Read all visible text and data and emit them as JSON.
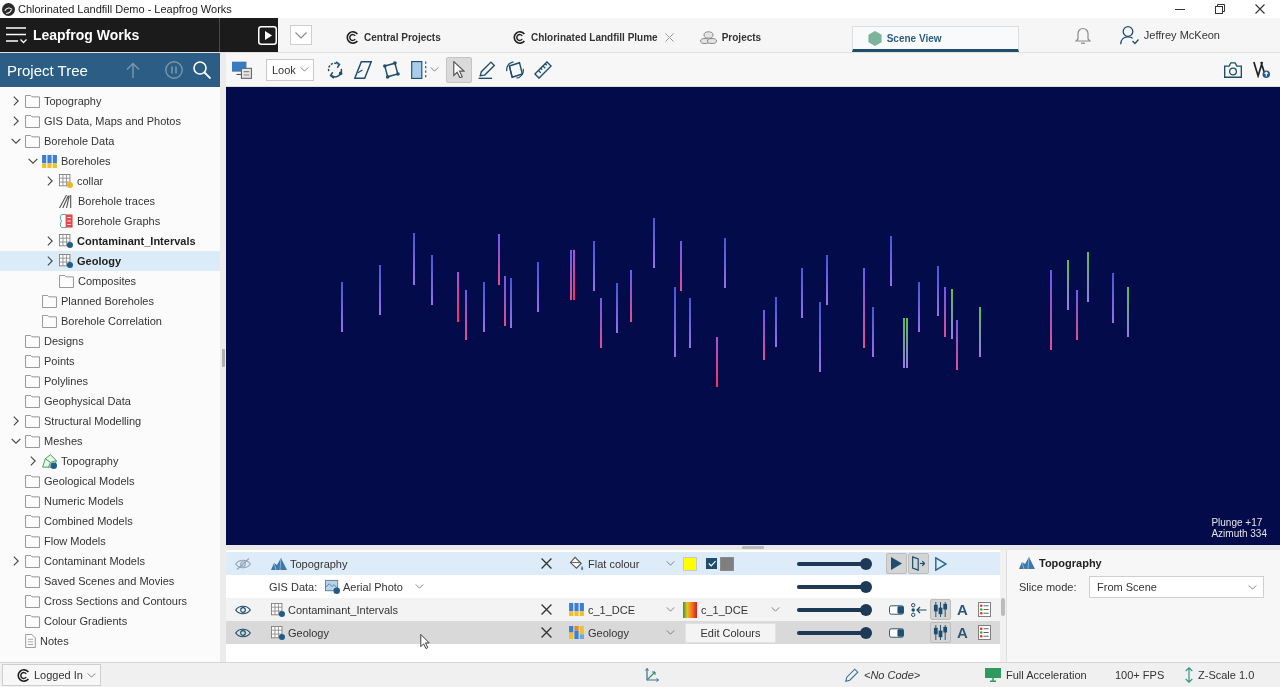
{
  "window": {
    "title": "Chlorinated Landfill Demo - Leapfrog Works"
  },
  "header": {
    "app_name": "Leapfrog Works",
    "tabs": [
      {
        "label": "Central Projects",
        "kind": "central",
        "closable": false,
        "selected": false
      },
      {
        "label": "Chlorinated Landfill Plume",
        "kind": "central",
        "closable": true,
        "selected": false
      },
      {
        "label": "Projects",
        "kind": "projects",
        "closable": false,
        "selected": false
      },
      {
        "label": "Scene View",
        "kind": "scene",
        "closable": false,
        "selected": true
      }
    ],
    "user": "Jeffrey McKeon"
  },
  "project_tree": {
    "title": "Project Tree",
    "tools": [
      {
        "kind": "up",
        "disabled": true
      },
      {
        "kind": "pause",
        "disabled": true
      },
      {
        "kind": "search",
        "disabled": false
      }
    ],
    "items": [
      {
        "label": "Topography",
        "kind": "folder",
        "expanded": false,
        "selected": false,
        "in_scene": false
      },
      {
        "label": "GIS Data, Maps and Photos",
        "kind": "folder",
        "expanded": false,
        "selected": false,
        "in_scene": false
      },
      {
        "label": "Borehole Data",
        "kind": "folder",
        "expanded": true,
        "selected": false,
        "in_scene": false,
        "children": [
          {
            "label": "Boreholes",
            "kind": "boreholes",
            "expanded": true,
            "selected": false,
            "in_scene": false,
            "children": [
              {
                "label": "collar",
                "kind": "table",
                "expanded": false,
                "selected": false,
                "in_scene": false
              },
              {
                "label": "Borehole traces",
                "kind": "traces",
                "selected": false,
                "in_scene": false
              },
              {
                "label": "Borehole Graphs",
                "kind": "graphs",
                "selected": false,
                "in_scene": false
              },
              {
                "label": "Contaminant_Intervals",
                "kind": "interval-table",
                "expanded": false,
                "selected": false,
                "in_scene": true
              },
              {
                "label": "Geology",
                "kind": "interval-table",
                "expanded": false,
                "selected": true,
                "in_scene": true
              },
              {
                "label": "Composites",
                "kind": "folder",
                "selected": false,
                "in_scene": false
              }
            ]
          },
          {
            "label": "Planned Boreholes",
            "kind": "folder",
            "selected": false,
            "in_scene": false
          },
          {
            "label": "Borehole Correlation",
            "kind": "folder",
            "selected": false,
            "in_scene": false
          }
        ]
      },
      {
        "label": "Designs",
        "kind": "folder",
        "selected": false,
        "in_scene": false
      },
      {
        "label": "Points",
        "kind": "folder",
        "selected": false,
        "in_scene": false
      },
      {
        "label": "Polylines",
        "kind": "folder",
        "selected": false,
        "in_scene": false
      },
      {
        "label": "Geophysical Data",
        "kind": "folder",
        "selected": false,
        "in_scene": false
      },
      {
        "label": "Structural Modelling",
        "kind": "folder",
        "expanded": false,
        "selected": false,
        "in_scene": false
      },
      {
        "label": "Meshes",
        "kind": "folder",
        "expanded": true,
        "selected": false,
        "in_scene": false,
        "children": [
          {
            "label": "Topography",
            "kind": "mesh",
            "expanded": false,
            "selected": false,
            "in_scene": false
          }
        ]
      },
      {
        "label": "Geological Models",
        "kind": "folder",
        "selected": false,
        "in_scene": false
      },
      {
        "label": "Numeric Models",
        "kind": "folder",
        "selected": false,
        "in_scene": false
      },
      {
        "label": "Combined Models",
        "kind": "folder",
        "selected": false,
        "in_scene": false
      },
      {
        "label": "Flow Models",
        "kind": "folder",
        "selected": false,
        "in_scene": false
      },
      {
        "label": "Contaminant Models",
        "kind": "folder",
        "expanded": false,
        "selected": false,
        "in_scene": false
      },
      {
        "label": "Saved Scenes and Movies",
        "kind": "folder",
        "selected": false,
        "in_scene": false
      },
      {
        "label": "Cross Sections and Contours",
        "kind": "folder",
        "selected": false,
        "in_scene": false
      },
      {
        "label": "Colour Gradients",
        "kind": "folder",
        "selected": false,
        "in_scene": false
      },
      {
        "label": "Notes",
        "kind": "notes",
        "selected": false,
        "in_scene": false
      }
    ]
  },
  "scene_toolbar": {
    "view_mode": "Look",
    "tools": [
      {
        "kind": "rotate",
        "pressed": false
      },
      {
        "kind": "plane",
        "pressed": false
      },
      {
        "kind": "plane-handles",
        "pressed": false
      },
      {
        "kind": "panel",
        "pressed": false
      },
      {
        "kind": "select",
        "pressed": true
      },
      {
        "kind": "draw-plane",
        "pressed": false
      },
      {
        "kind": "plane-rotate",
        "pressed": false
      },
      {
        "kind": "ruler",
        "pressed": false
      }
    ]
  },
  "scene": {
    "plunge": "Plunge +17",
    "azimuth": "Azimuth 334"
  },
  "shape_list": {
    "rows": [
      {
        "kind": "mesh",
        "name": "Topography",
        "visible": false,
        "selected": true,
        "hovered": false,
        "style": {
          "kind": "flat",
          "label": "Flat colour"
        },
        "colour": {
          "kind": "swatch",
          "color": "#ffff00"
        },
        "edge": {
          "checked": true,
          "color": "#7f7f7f"
        },
        "level": 1,
        "tools": [
          {
            "kind": "play",
            "pressed": true
          },
          {
            "kind": "slice",
            "pressed": true
          },
          {
            "kind": "outline-play",
            "pressed": false
          }
        ]
      },
      {
        "kind": "source",
        "label": "GIS Data:",
        "value": "Aerial Photo",
        "level": 1
      },
      {
        "kind": "table",
        "name": "Contaminant_Intervals",
        "visible": true,
        "selected": false,
        "hovered": false,
        "style": {
          "kind": "numeric",
          "label": "c_1_DCE"
        },
        "colour": {
          "kind": "gradient",
          "label": "c_1_DCE"
        },
        "level": 1,
        "tools": [
          {
            "kind": "toggle",
            "pressed": false
          },
          {
            "kind": "filter",
            "pressed": false
          },
          {
            "kind": "bars",
            "pressed": true
          },
          {
            "kind": "label",
            "glyph": "A",
            "pressed": false
          },
          {
            "kind": "legend",
            "pressed": false
          }
        ]
      },
      {
        "kind": "table",
        "name": "Geology",
        "visible": true,
        "selected": false,
        "hovered": true,
        "style": {
          "kind": "category",
          "label": "Geology"
        },
        "colour": {
          "kind": "button",
          "label": "Edit Colours"
        },
        "level": 1,
        "tools": [
          {
            "kind": "toggle",
            "pressed": false
          },
          {
            "kind": "bars",
            "pressed": true
          },
          {
            "kind": "label",
            "glyph": "A",
            "pressed": false
          },
          {
            "kind": "legend",
            "pressed": false
          }
        ]
      }
    ]
  },
  "properties": {
    "title": "Topography",
    "fields": [
      {
        "label": "Slice mode:",
        "value": "From Scene"
      }
    ]
  },
  "status_bar": {
    "login": "Logged In",
    "code": "<No Code>",
    "acceleration": "Full Acceleration",
    "fps": "100+ FPS",
    "z_scale": "Z-Scale 1.0"
  }
}
